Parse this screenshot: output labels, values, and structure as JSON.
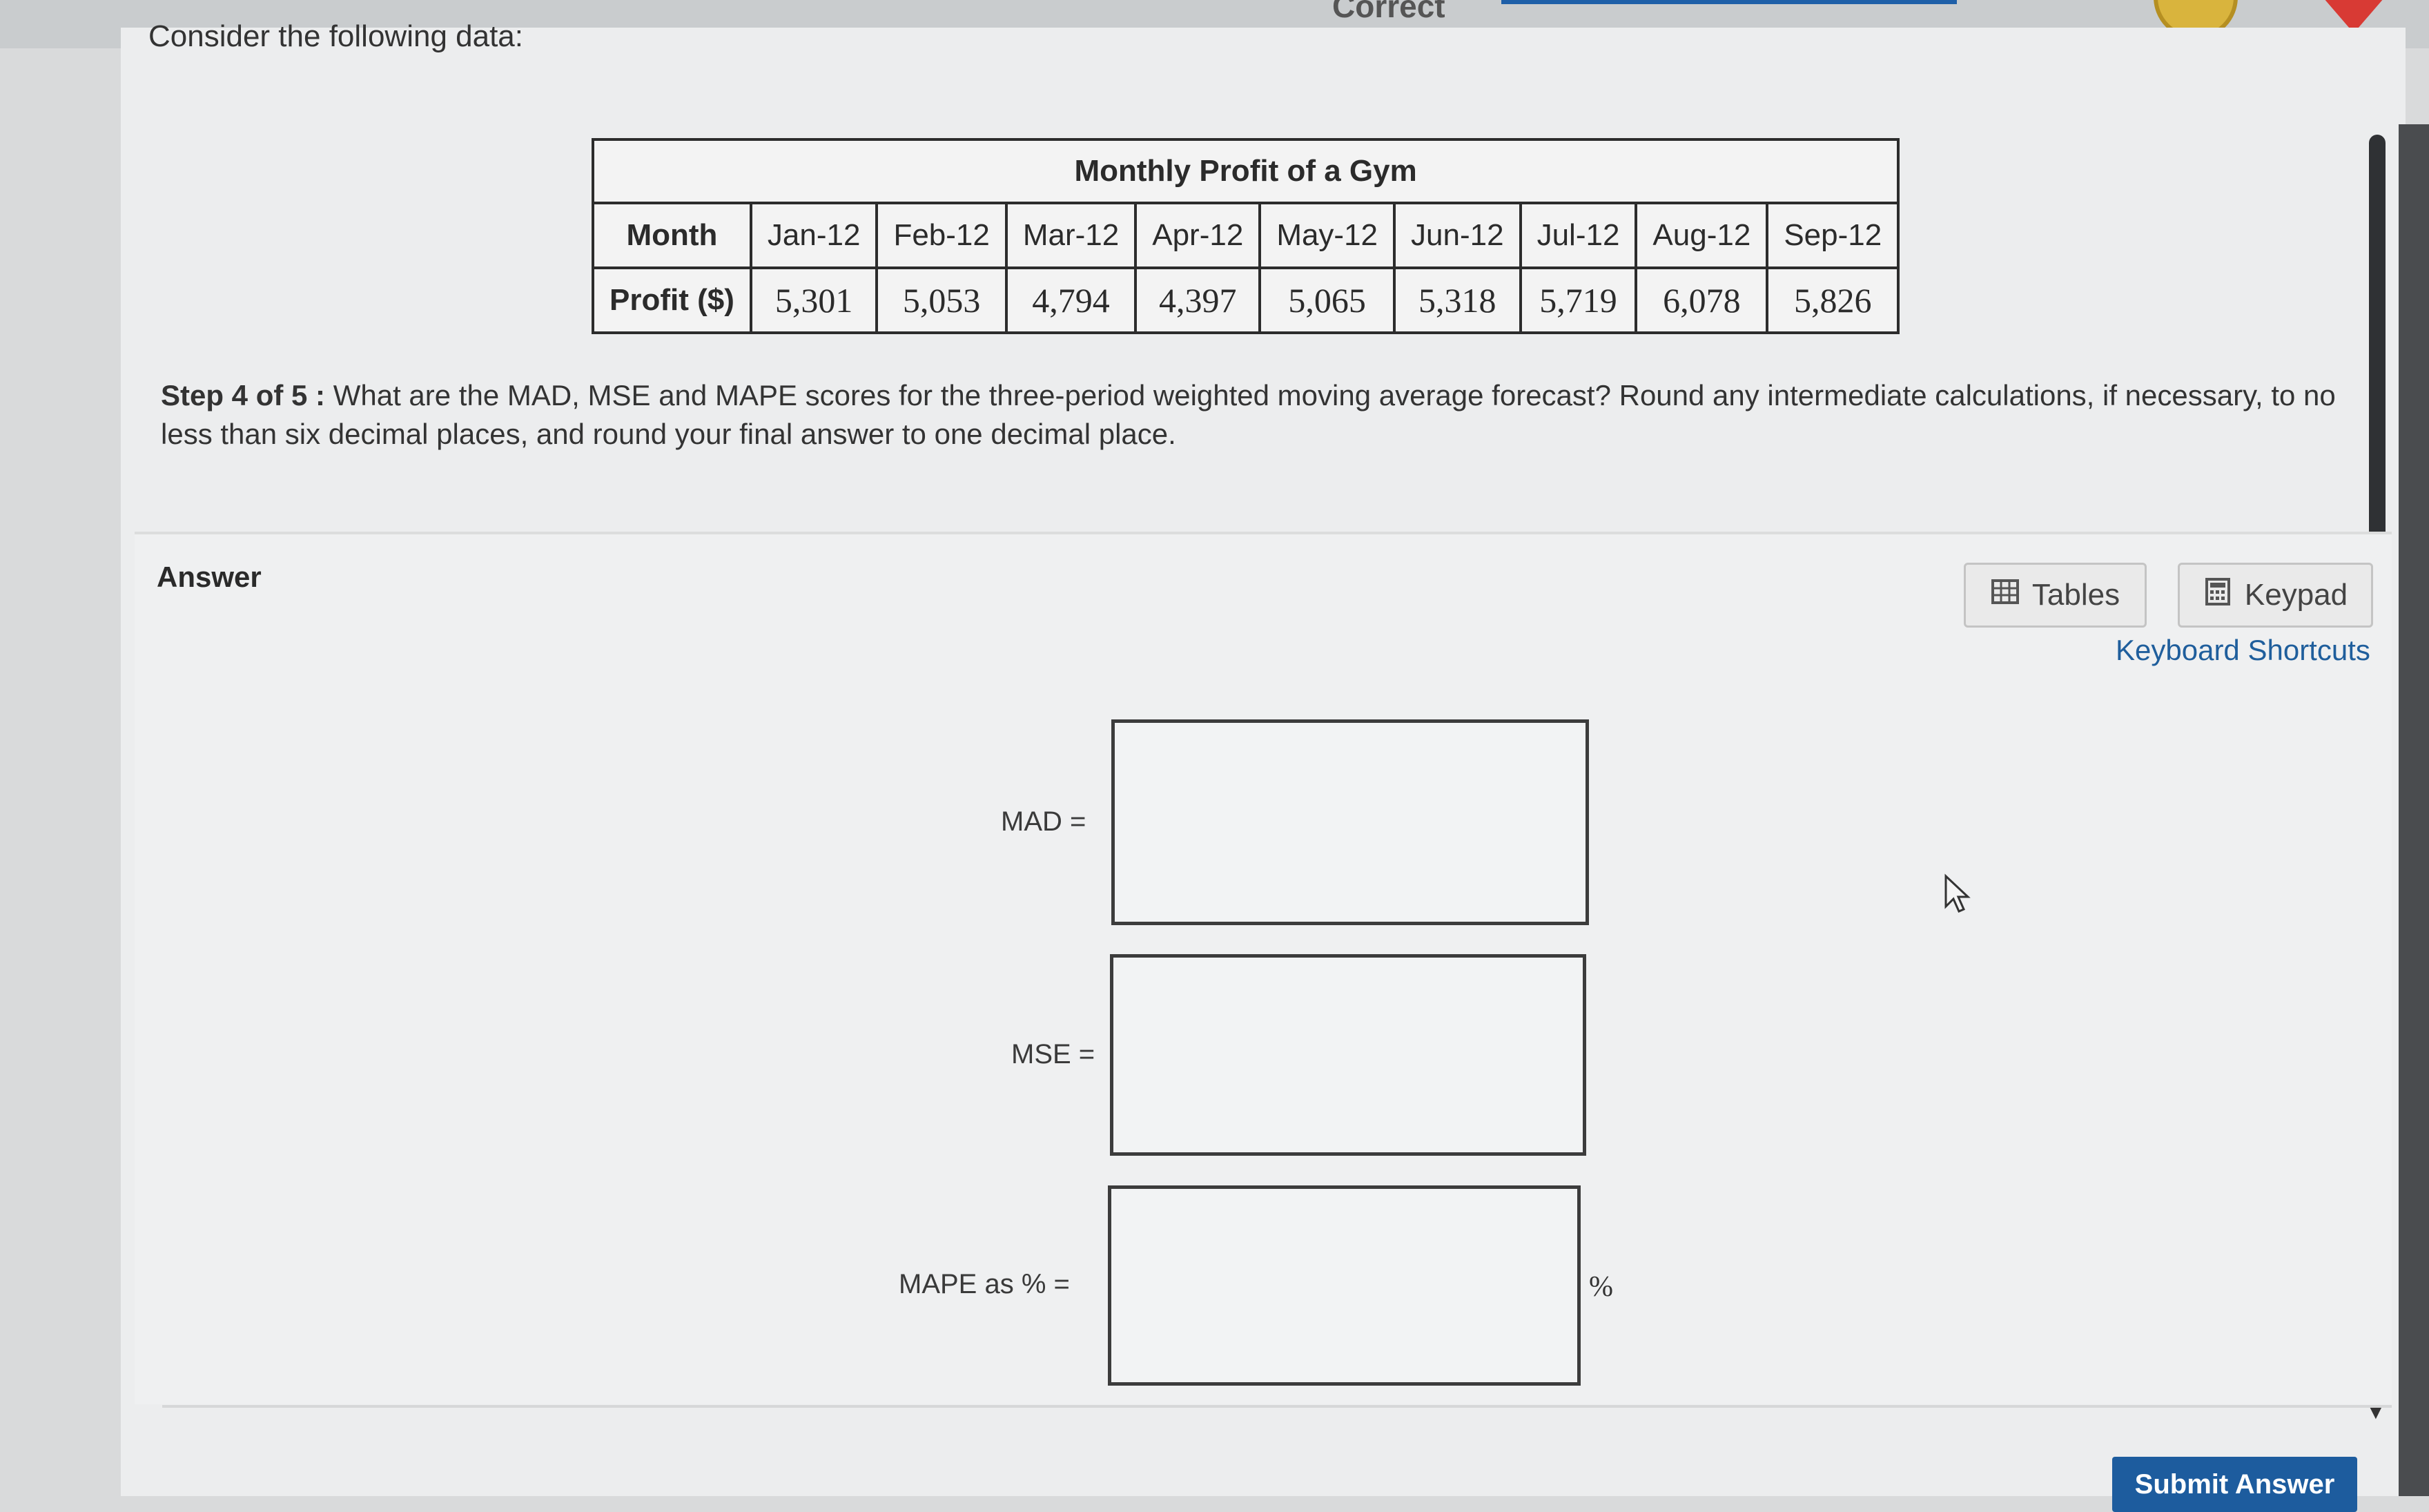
{
  "header": {
    "status_fragment": "Correct"
  },
  "question": {
    "intro": "Consider the following data:",
    "table": {
      "title": "Monthly Profit of a Gym",
      "row_headers": [
        "Month",
        "Profit ($)"
      ],
      "months": [
        "Jan-12",
        "Feb-12",
        "Mar-12",
        "Apr-12",
        "May-12",
        "Jun-12",
        "Jul-12",
        "Aug-12",
        "Sep-12"
      ],
      "profits": [
        "5,301",
        "5,053",
        "4,794",
        "4,397",
        "5,065",
        "5,318",
        "5,719",
        "6,078",
        "5,826"
      ]
    },
    "step_label": "Step 4 of 5 :",
    "step_text": "What are the MAD, MSE and MAPE scores for the three-period weighted moving average forecast? Round any intermediate calculations, if necessary, to no less than six decimal places, and round your final answer to one decimal place."
  },
  "answer": {
    "label": "Answer",
    "tables_button": "Tables",
    "keypad_button": "Keypad",
    "shortcuts_link": "Keyboard Shortcuts",
    "mad_label": "MAD =",
    "mse_label": "MSE =",
    "mape_label": "MAPE as % =",
    "percent_suffix": "%",
    "mad_value": "",
    "mse_value": "",
    "mape_value": "",
    "submit_button": "Submit Answer"
  },
  "icons": {
    "tables": "table-grid-icon",
    "keypad": "calculator-icon",
    "cursor": "mouse-pointer-icon",
    "coin": "coin-icon",
    "heart": "heart-icon"
  },
  "colors": {
    "accent": "#1d5c9e",
    "link": "#1f5e9c"
  }
}
